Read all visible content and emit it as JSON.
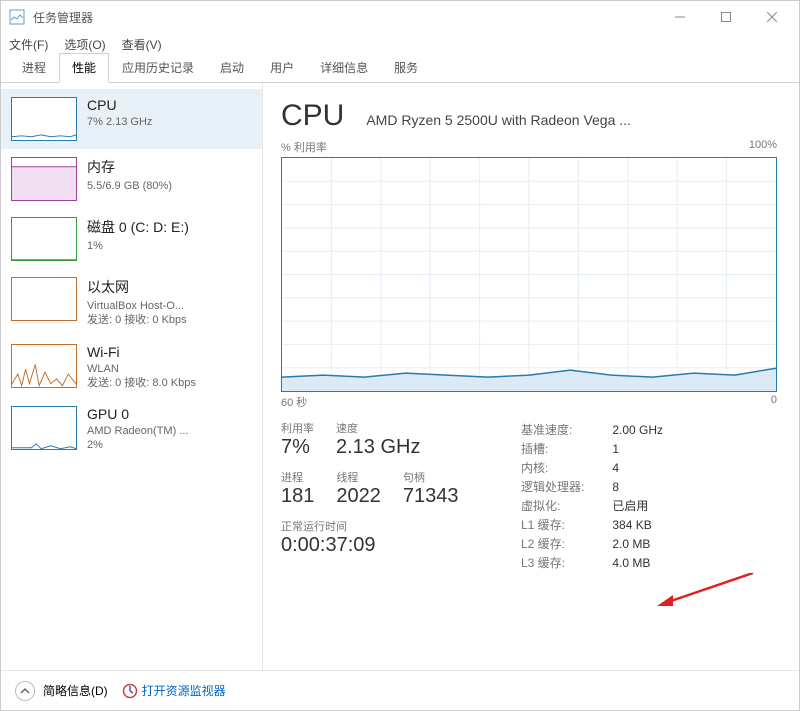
{
  "window": {
    "title": "任务管理器"
  },
  "menu": {
    "file": "文件(F)",
    "options": "选项(O)",
    "view": "查看(V)"
  },
  "tabs": {
    "processes": "进程",
    "performance": "性能",
    "app_history": "应用历史记录",
    "startup": "启动",
    "users": "用户",
    "details": "详细信息",
    "services": "服务"
  },
  "sidebar": [
    {
      "title": "CPU",
      "sub1": "7% 2.13 GHz",
      "sub2": ""
    },
    {
      "title": "内存",
      "sub1": "5.5/6.9 GB (80%)",
      "sub2": ""
    },
    {
      "title": "磁盘 0 (C: D: E:)",
      "sub1": "1%",
      "sub2": ""
    },
    {
      "title": "以太网",
      "sub1": "VirtualBox Host-O...",
      "sub2": "发送: 0 接收: 0 Kbps"
    },
    {
      "title": "Wi-Fi",
      "sub1": "WLAN",
      "sub2": "发送: 0 接收: 8.0 Kbps"
    },
    {
      "title": "GPU 0",
      "sub1": "AMD Radeon(TM) ...",
      "sub2": "2%"
    }
  ],
  "detail": {
    "heading": "CPU",
    "model": "AMD Ryzen 5 2500U with Radeon Vega ...",
    "graph_top_left": "% 利用率",
    "graph_top_right": "100%",
    "graph_bottom_left": "60 秒",
    "graph_bottom_right": "0",
    "stats": {
      "utilization_label": "利用率",
      "utilization_value": "7%",
      "speed_label": "速度",
      "speed_value": "2.13 GHz",
      "processes_label": "进程",
      "processes_value": "181",
      "threads_label": "线程",
      "threads_value": "2022",
      "handles_label": "句柄",
      "handles_value": "71343",
      "uptime_label": "正常运行时间",
      "uptime_value": "0:00:37:09"
    },
    "info": {
      "base_speed_k": "基准速度:",
      "base_speed_v": "2.00 GHz",
      "sockets_k": "插槽:",
      "sockets_v": "1",
      "cores_k": "内核:",
      "cores_v": "4",
      "logical_k": "逻辑处理器:",
      "logical_v": "8",
      "virt_k": "虚拟化:",
      "virt_v": "已启用",
      "l1_k": "L1 缓存:",
      "l1_v": "384 KB",
      "l2_k": "L2 缓存:",
      "l2_v": "2.0 MB",
      "l3_k": "L3 缓存:",
      "l3_v": "4.0 MB"
    }
  },
  "bottom": {
    "fewer_details": "简略信息(D)",
    "resource_monitor": "打开资源监视器"
  },
  "chart_data": {
    "type": "line",
    "title": "% 利用率",
    "xlabel": "60 秒 → 0",
    "ylabel": "% 利用率",
    "ylim": [
      0,
      100
    ],
    "x_seconds_ago": [
      60,
      55,
      50,
      45,
      40,
      35,
      30,
      25,
      20,
      15,
      10,
      5,
      0
    ],
    "values": [
      6,
      7,
      6,
      8,
      7,
      6,
      7,
      9,
      7,
      6,
      8,
      7,
      10
    ]
  }
}
